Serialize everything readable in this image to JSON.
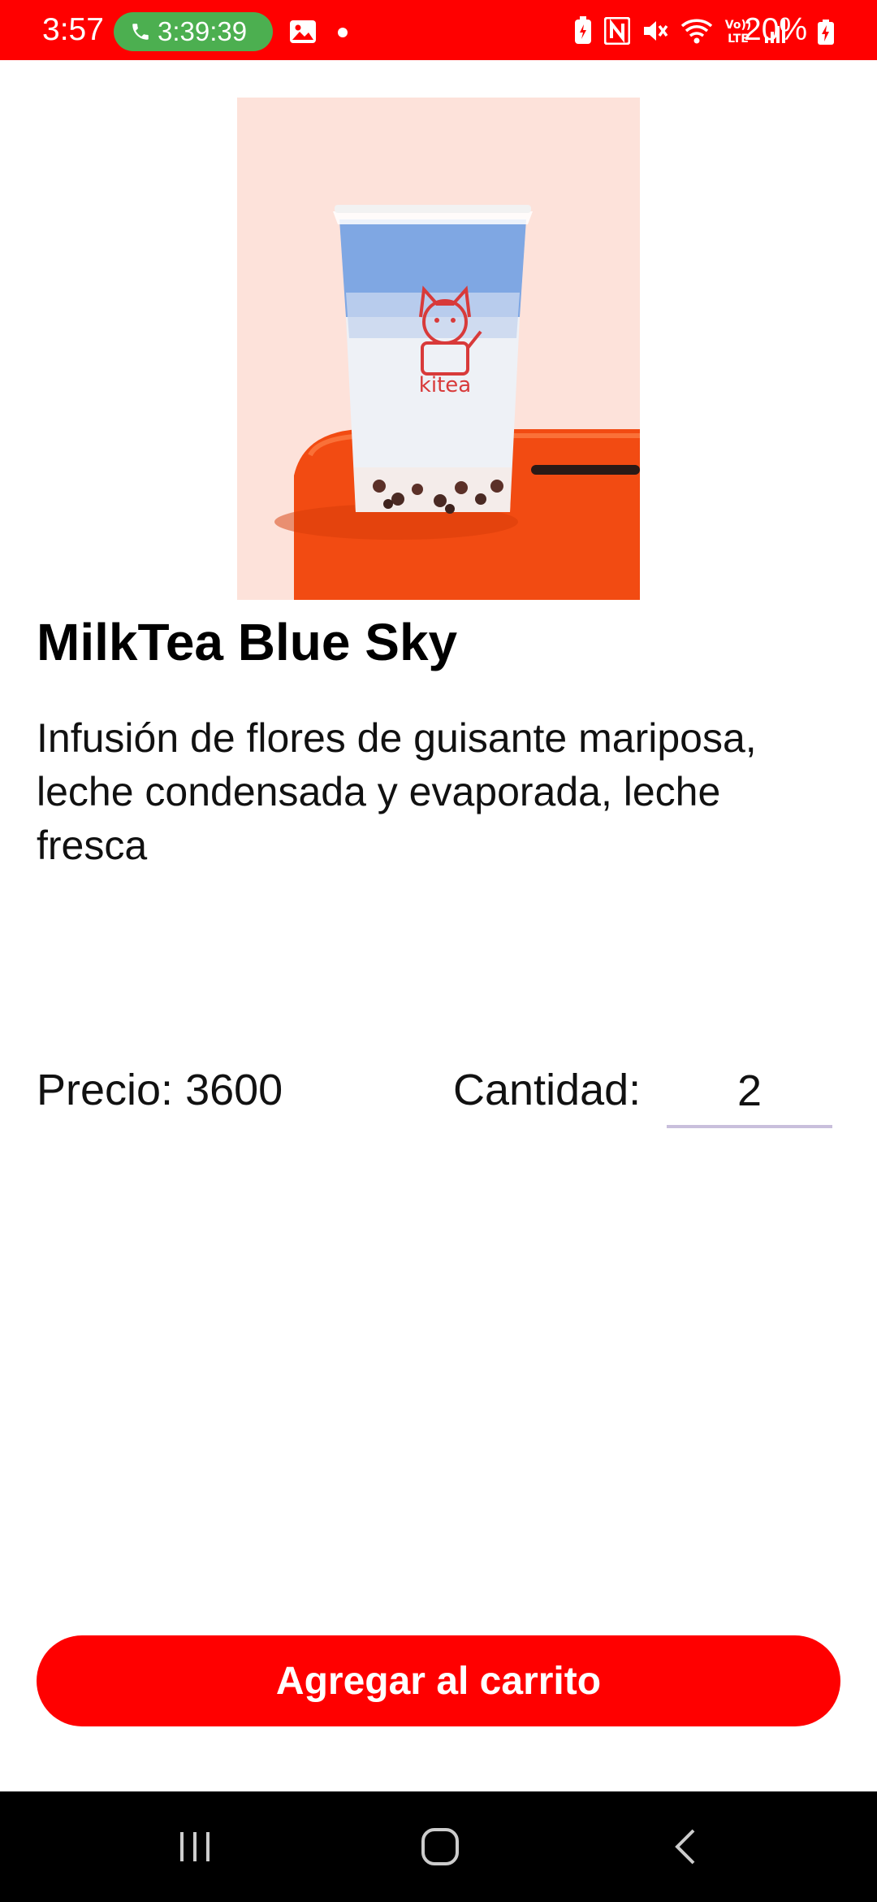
{
  "status_bar": {
    "time": "3:57",
    "call_timer": "3:39:39",
    "battery_percent": "20%",
    "icons": [
      "phone-icon",
      "image-icon",
      "notification-dot-icon",
      "battery-saver-icon",
      "nfc-icon",
      "mute-icon",
      "wifi-icon",
      "volte-icon",
      "signal-icon",
      "battery-charging-icon"
    ],
    "background_color": "#ff0000",
    "call_pill_color": "#4caf50"
  },
  "product": {
    "image_brand_text": "kitea",
    "title": "MilkTea Blue Sky",
    "description": "Infusión de flores de guisante mariposa, leche condensada y evaporada, leche fresca",
    "price_label": "Precio: 3600",
    "quantity_label": "Cantidad:",
    "quantity_value": "2"
  },
  "actions": {
    "add_to_cart_label": "Agregar al carrito",
    "accent_color": "#ff0000"
  },
  "nav_bar": {
    "icons": [
      "recent-apps-icon",
      "home-icon",
      "back-icon"
    ]
  }
}
